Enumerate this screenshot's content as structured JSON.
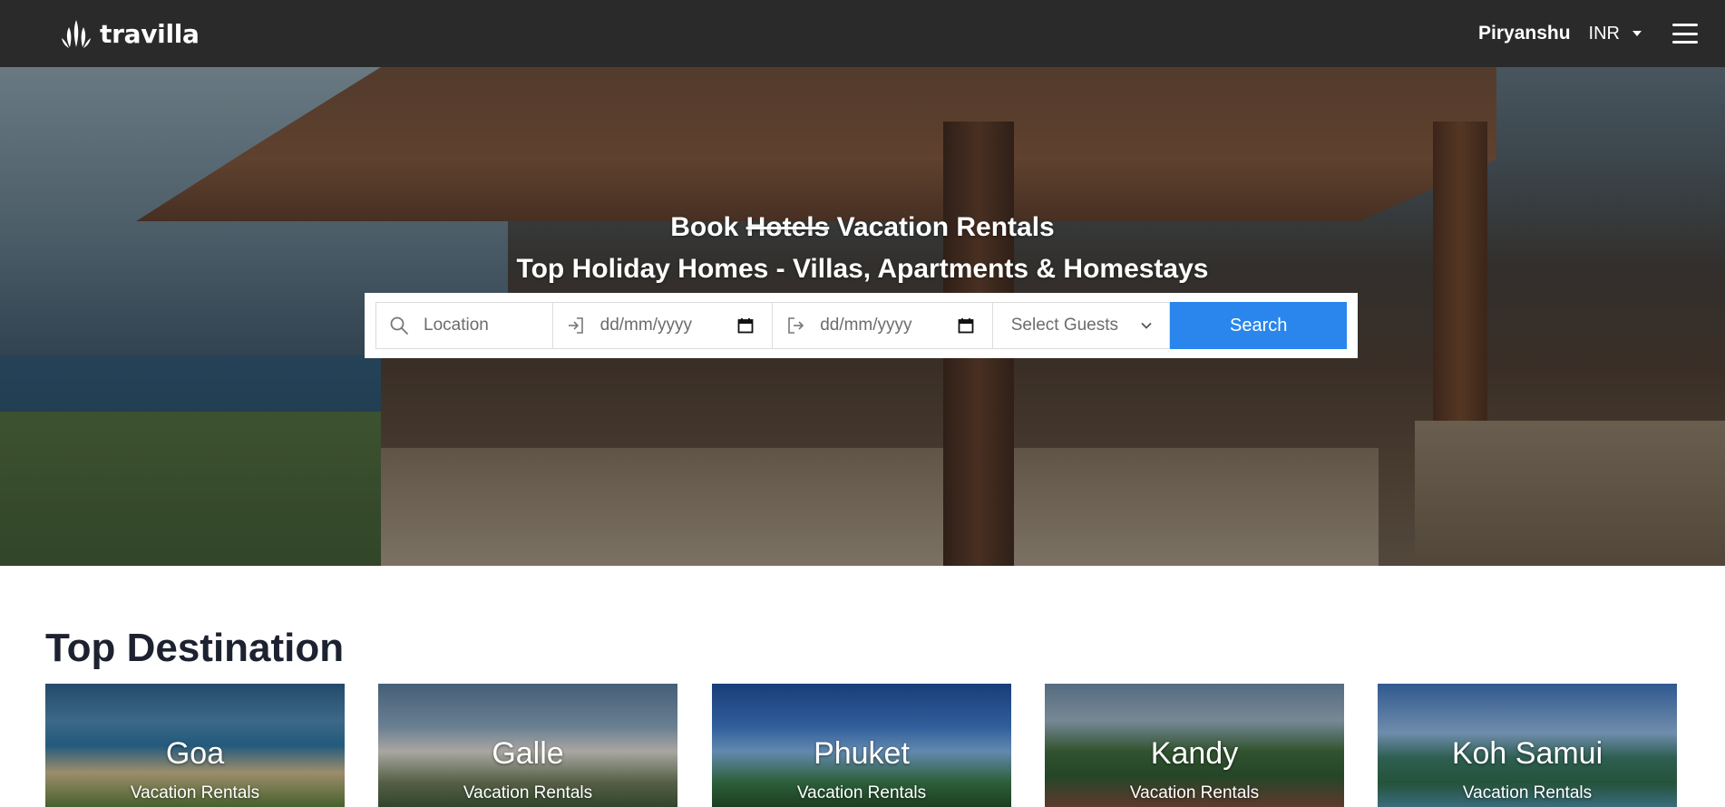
{
  "navbar": {
    "brand": "travilla",
    "user": "Piryanshu",
    "currency": "INR"
  },
  "hero": {
    "title_prefix": "Book",
    "title_struck": "Hotels",
    "title_suffix": "Vacation Rentals",
    "subtitle": "Top Holiday Homes - Villas, Apartments & Homestays"
  },
  "search": {
    "location_placeholder": "Location",
    "checkin_placeholder": "dd/mm/yyyy",
    "checkout_placeholder": "dd/mm/yyyy",
    "guests_label": "Select Guests",
    "button": "Search"
  },
  "destinations": {
    "title": "Top Destination",
    "items": [
      {
        "name": "Goa",
        "subtitle": "Vacation Rentals"
      },
      {
        "name": "Galle",
        "subtitle": "Vacation Rentals"
      },
      {
        "name": "Phuket",
        "subtitle": "Vacation Rentals"
      },
      {
        "name": "Kandy",
        "subtitle": "Vacation Rentals"
      },
      {
        "name": "Koh Samui",
        "subtitle": "Vacation Rentals"
      }
    ]
  },
  "icons": {
    "brand": "travilla-logo-icon",
    "caret": "caret-down-icon",
    "menu": "hamburger-menu-icon",
    "location": "search-icon",
    "checkin": "sign-in-icon",
    "checkout": "sign-out-icon",
    "calendar": "calendar-icon",
    "guests": "chevron-down-icon"
  },
  "colors": {
    "navbar": "#2a2a2a",
    "search_button": "#2a86ec",
    "heading": "#1d2230"
  }
}
